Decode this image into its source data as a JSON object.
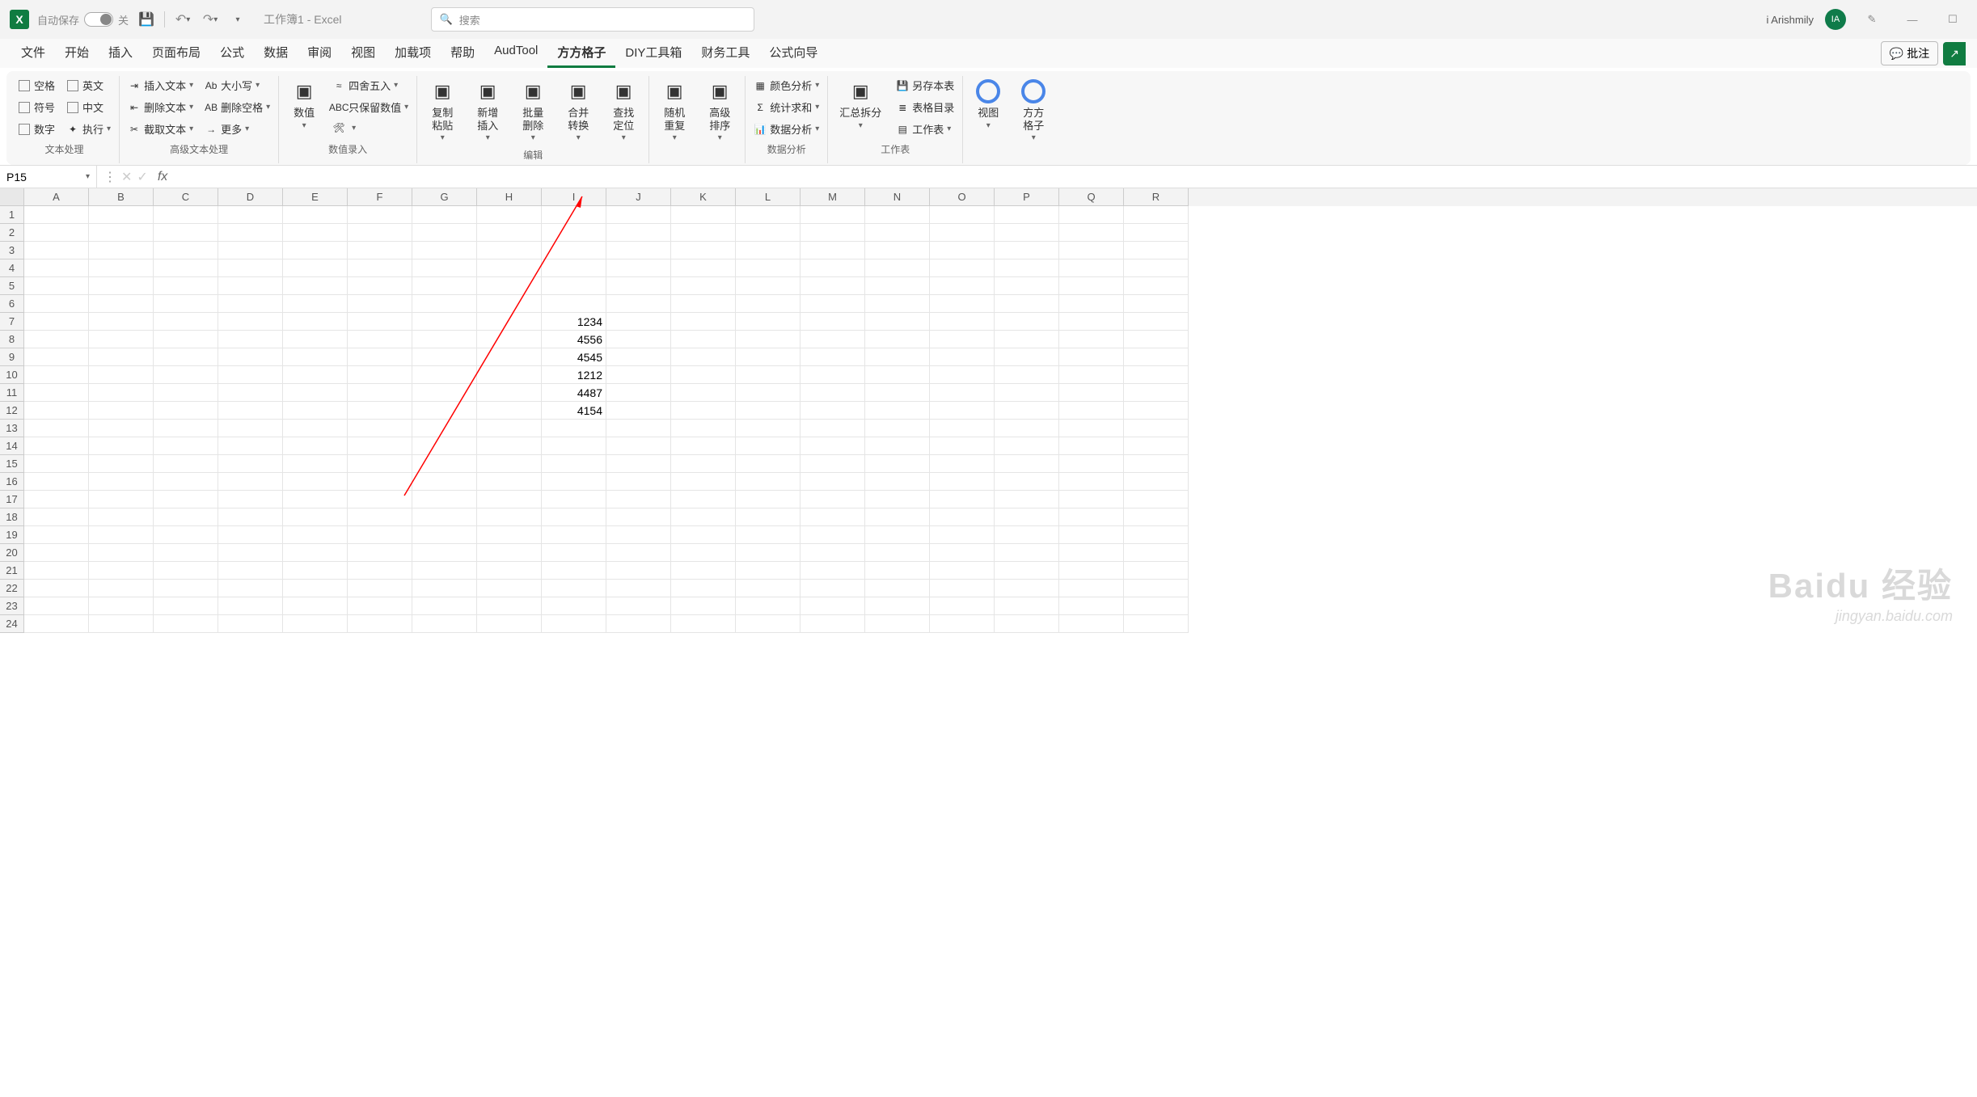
{
  "titlebar": {
    "autosave_label": "自动保存",
    "autosave_state": "关",
    "doc_title": "工作簿1 - Excel",
    "search_placeholder": "搜索",
    "user_name": "i Arishmily",
    "user_initials": "IA"
  },
  "tabs": {
    "items": [
      "文件",
      "开始",
      "插入",
      "页面布局",
      "公式",
      "数据",
      "审阅",
      "视图",
      "加载项",
      "帮助",
      "AudTool",
      "方方格子",
      "DIY工具箱",
      "财务工具",
      "公式向导"
    ],
    "active_index": 11,
    "comment_label": "批注",
    "share_label": ""
  },
  "ribbon": {
    "groups": [
      {
        "label": "文本处理",
        "cols": [
          [
            {
              "icon": "chk",
              "label": "空格"
            },
            {
              "icon": "chk",
              "label": "符号"
            },
            {
              "icon": "chk",
              "label": "数字"
            }
          ],
          [
            {
              "icon": "chk",
              "label": "英文"
            },
            {
              "icon": "chk",
              "label": "中文"
            },
            {
              "icon": "star",
              "label": "执行",
              "caret": true
            }
          ]
        ]
      },
      {
        "label": "高级文本处理",
        "cols": [
          [
            {
              "icon": "ins",
              "label": "插入文本",
              "caret": true
            },
            {
              "icon": "del",
              "label": "删除文本",
              "caret": true
            },
            {
              "icon": "cut",
              "label": "截取文本",
              "caret": true
            }
          ],
          [
            {
              "icon": "Ab",
              "label": "大小写",
              "caret": true
            },
            {
              "icon": "AB",
              "label": "删除空格",
              "caret": true
            },
            {
              "icon": "arrow",
              "label": "更多",
              "caret": true
            }
          ]
        ]
      },
      {
        "label": "数值录入",
        "big_left": {
          "icon": "()",
          "label": "数值",
          "caret": true
        },
        "cols": [
          [
            {
              "icon": "round",
              "label": "四舍五入",
              "caret": true
            },
            {
              "icon": "ABC",
              "label": "只保留数值",
              "caret": true
            },
            {
              "icon": "tools",
              "label": "",
              "caret": true
            }
          ]
        ]
      },
      {
        "label": "编辑",
        "big_items": [
          {
            "icon": "paste",
            "label": "复制粘贴",
            "caret": true
          },
          {
            "icon": "insert",
            "label": "新增插入",
            "caret": true
          },
          {
            "icon": "delete",
            "label": "批量删除",
            "caret": true
          },
          {
            "icon": "merge",
            "label": "合并转换",
            "caret": true
          },
          {
            "icon": "find",
            "label": "查找定位",
            "caret": true
          }
        ]
      },
      {
        "label": "",
        "big_items": [
          {
            "icon": "shuffle",
            "label": "随机重复",
            "caret": true
          },
          {
            "icon": "sort",
            "label": "高级排序",
            "caret": true
          }
        ]
      },
      {
        "label": "数据分析",
        "cols": [
          [
            {
              "icon": "color",
              "label": "颜色分析",
              "caret": true
            },
            {
              "icon": "sum",
              "label": "统计求和",
              "caret": true
            },
            {
              "icon": "chart",
              "label": "数据分析",
              "caret": true
            }
          ]
        ]
      },
      {
        "label": "工作表",
        "big_left": {
          "icon": "split",
          "label": "汇总拆分",
          "caret": true
        },
        "cols": [
          [
            {
              "icon": "save",
              "label": "另存本表"
            },
            {
              "icon": "toc",
              "label": "表格目录"
            },
            {
              "icon": "sheets",
              "label": "工作表",
              "caret": true
            }
          ]
        ]
      },
      {
        "label": "",
        "big_items": [
          {
            "icon": "circle-blue",
            "label": "视图",
            "caret": true
          },
          {
            "icon": "circle-blue",
            "label": "方方格子",
            "caret": true
          }
        ]
      }
    ]
  },
  "formula_bar": {
    "namebox": "P15",
    "formula": ""
  },
  "grid": {
    "columns": [
      "A",
      "B",
      "C",
      "D",
      "E",
      "F",
      "G",
      "H",
      "I",
      "J",
      "K",
      "L",
      "M",
      "N",
      "O",
      "P",
      "Q",
      "R"
    ],
    "row_count": 24,
    "data": {
      "I7": "1234",
      "I8": "4556",
      "I9": "4545",
      "I10": "1212",
      "I11": "4487",
      "I12": "4154"
    }
  },
  "watermark": {
    "line1": "Baidu 经验",
    "line2": "jingyan.baidu.com"
  }
}
